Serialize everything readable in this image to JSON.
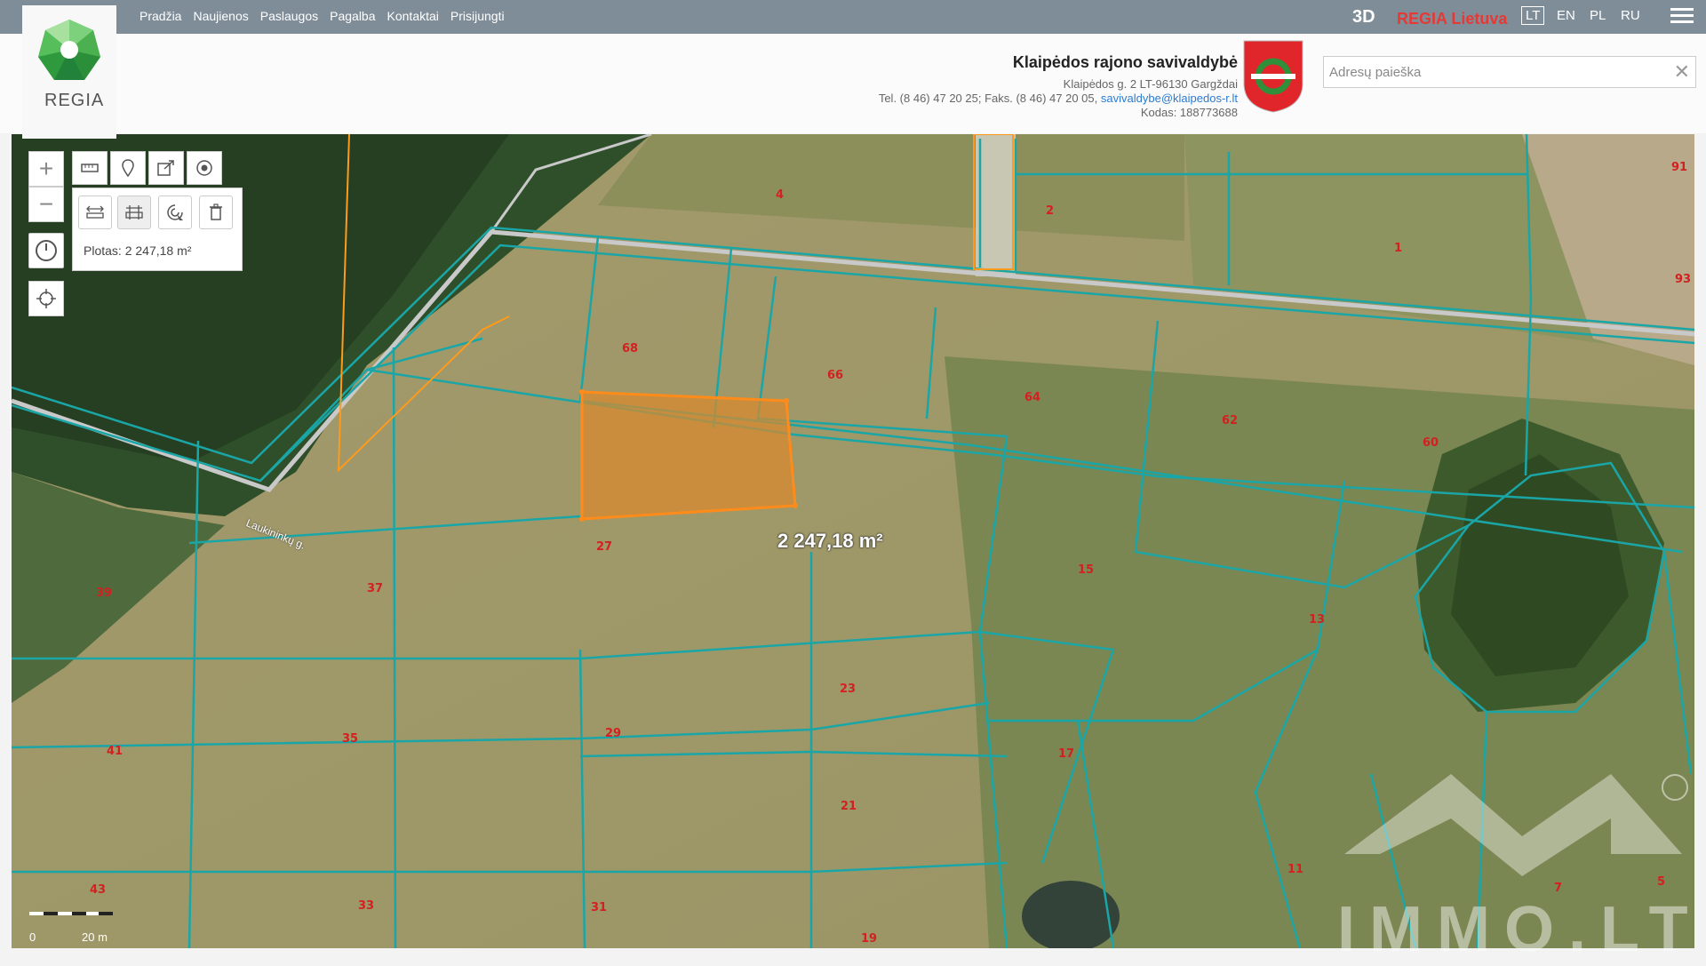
{
  "nav": {
    "items": [
      "Pradžia",
      "Naujienos",
      "Paslaugos",
      "Pagalba",
      "Kontaktai",
      "Prisijungti"
    ]
  },
  "topbar": {
    "btn_3d": "3D",
    "regia_lietuva": "REGIA Lietuva",
    "languages": [
      "LT",
      "EN",
      "PL",
      "RU"
    ],
    "active_language": "LT"
  },
  "logo": {
    "text": "REGIA"
  },
  "organization": {
    "title": "Klaipėdos rajono savivaldybė",
    "address": "Klaipėdos g. 2 LT-96130 Gargždai",
    "phone": "Tel. (8 46) 47 20 25; Faks. (8 46) 47 20 05,",
    "email": "savivaldybe@klaipedos-r.lt",
    "code": "Kodas: 188773688"
  },
  "search": {
    "placeholder": "Adresų paieška",
    "clear": "✕"
  },
  "measure": {
    "area_readout": "Plotas: 2 247,18 m²",
    "area_center": "2 247,18 m²"
  },
  "map": {
    "road_label": "Laukininkų g.",
    "scale_zero": "0",
    "scale_length": "20 m",
    "watermark": "IMMO.LT",
    "parcel_numbers": [
      "91",
      "4",
      "2",
      "1",
      "93",
      "68",
      "66",
      "64",
      "62",
      "60",
      "27",
      "15",
      "13",
      "39",
      "37",
      "23",
      "35",
      "29",
      "41",
      "21",
      "17",
      "11",
      "43",
      "33",
      "31",
      "19",
      "7",
      "5"
    ]
  },
  "colors": {
    "topbar": "#7f8d99",
    "parcel_line": "#1aa6a6",
    "selected_parcel": "#ff8c1a",
    "parcel_label": "#d32020",
    "brand_red": "#e53935"
  }
}
